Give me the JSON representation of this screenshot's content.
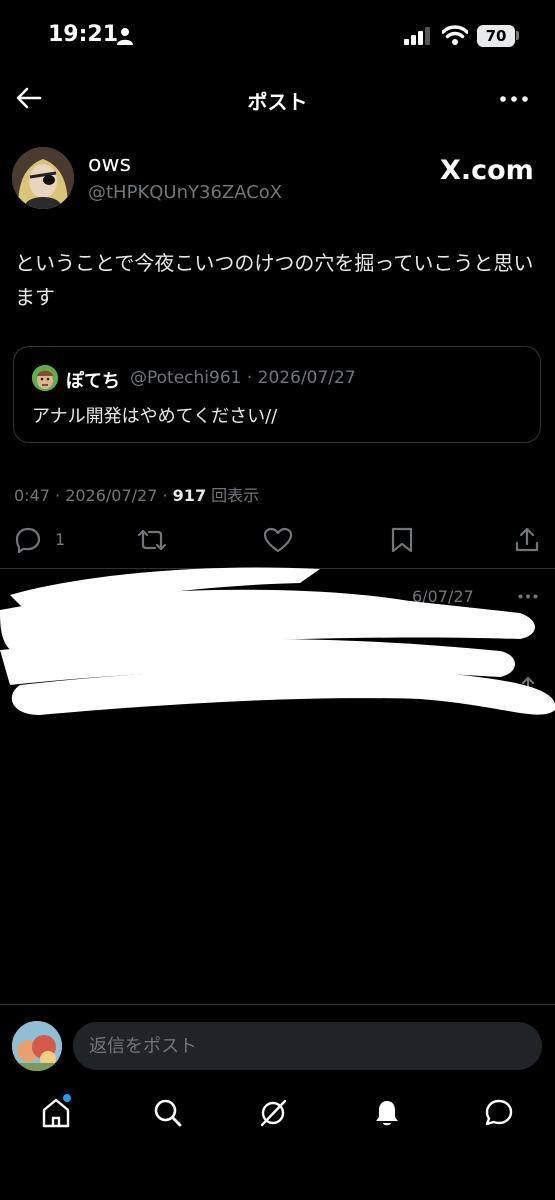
{
  "status_bar": {
    "time": "19:21",
    "battery": "70"
  },
  "header": {
    "title": "ポスト"
  },
  "post": {
    "display_name": "ows",
    "handle": "@tHPKQUnY36ZACoX",
    "source_badge": "X.com",
    "text": "ということで今夜こいつのけつの穴を掘っていこうと思います",
    "quote": {
      "name": "ぽてち",
      "meta": "@Potechi961 · 2026/07/27",
      "text": "アナル開発はやめてください//"
    },
    "time": "0:47 · 2026/07/27 · ",
    "views_count": "917",
    "views_label": " 回表示",
    "reply_count": "1"
  },
  "next_post": {
    "date_fragment": "6/07/27"
  },
  "reply_bar": {
    "placeholder": "返信をポスト"
  },
  "colors": {
    "background": "#000000",
    "text": "#e7e9ea",
    "muted": "#71767b",
    "accent": "#1d9bf0",
    "divider": "#2f3336"
  },
  "icons": {
    "back": "arrow-left-icon",
    "more": "more-horizontal-icon",
    "reply": "reply-icon",
    "repost": "repost-icon",
    "like": "heart-icon",
    "bookmark": "bookmark-icon",
    "share": "share-icon",
    "tabs": [
      "home-icon",
      "search-icon",
      "grok-icon",
      "bell-icon",
      "messages-icon"
    ]
  }
}
